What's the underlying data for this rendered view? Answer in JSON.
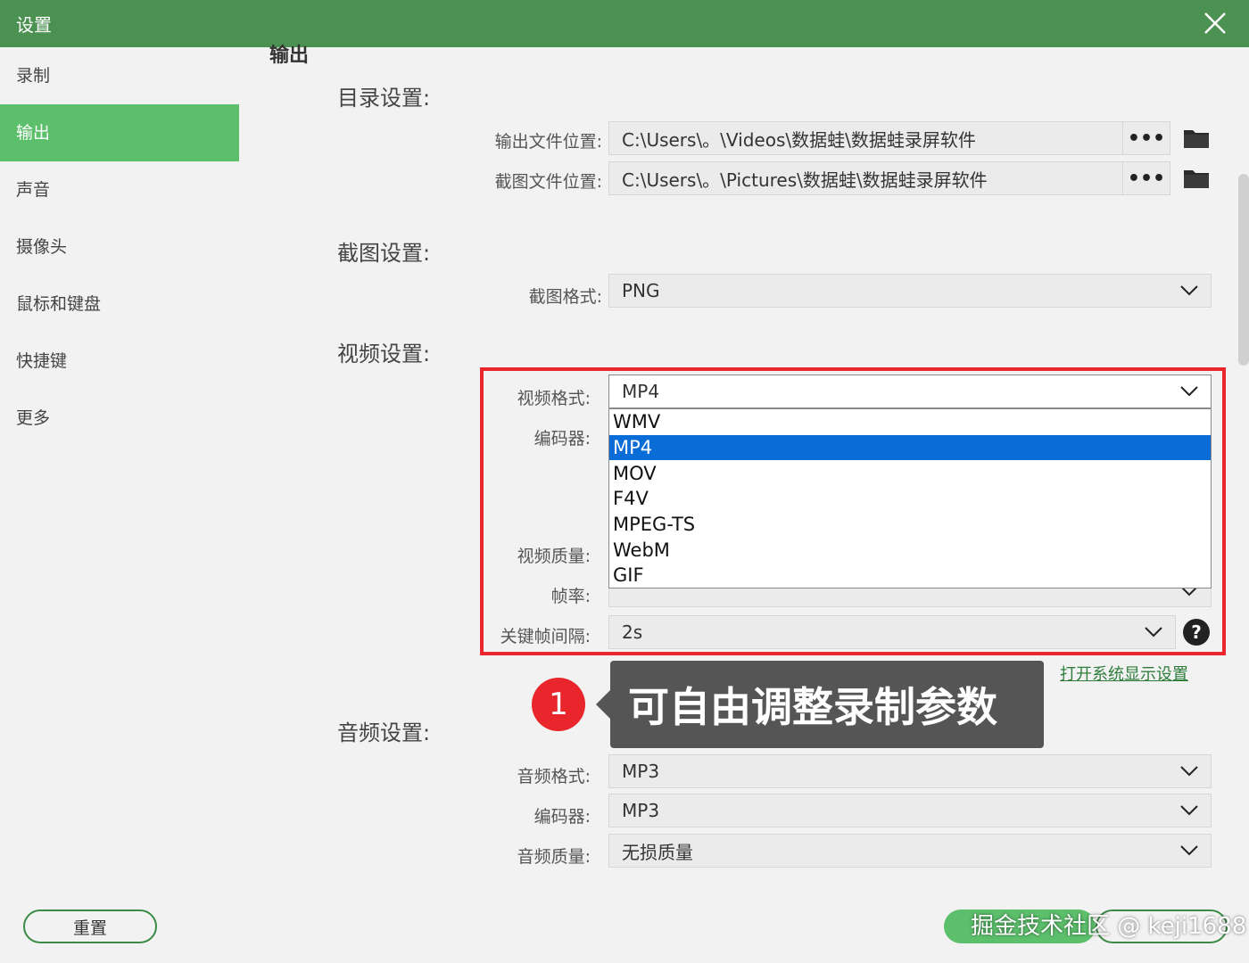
{
  "window": {
    "title": "设置"
  },
  "sidebar": {
    "items": [
      {
        "label": "录制"
      },
      {
        "label": "输出",
        "active": true
      },
      {
        "label": "声音"
      },
      {
        "label": "摄像头"
      },
      {
        "label": "鼠标和键盘"
      },
      {
        "label": "快捷键"
      },
      {
        "label": "更多"
      }
    ]
  },
  "page": {
    "heading": "输出"
  },
  "directory": {
    "heading": "目录设置:",
    "output_label": "输出文件位置:",
    "output_path": "C:\\Users\\。\\Videos\\数据蛙\\数据蛙录屏软件",
    "screenshot_label": "截图文件位置:",
    "screenshot_path": "C:\\Users\\。\\Pictures\\数据蛙\\数据蛙录屏软件",
    "browse_label": "•••"
  },
  "screenshot": {
    "heading": "截图设置:",
    "format_label": "截图格式:",
    "format_value": "PNG"
  },
  "video": {
    "heading": "视频设置:",
    "format_label": "视频格式:",
    "format_value": "MP4",
    "encoder_label": "编码器:",
    "quality_label": "视频质量:",
    "fps_label": "帧率:",
    "keyframe_label": "关键帧间隔:",
    "keyframe_value": "2s",
    "options": [
      "WMV",
      "MP4",
      "MOV",
      "F4V",
      "MPEG-TS",
      "WebM",
      "GIF"
    ],
    "selected_option": "MP4"
  },
  "display_link": "打开系统显示设置",
  "annotation": {
    "number": "1",
    "text": "可自由调整录制参数"
  },
  "audio": {
    "heading": "音频设置:",
    "format_label": "音频格式:",
    "format_value": "MP3",
    "encoder_label": "编码器:",
    "encoder_value": "MP3",
    "quality_label": "音频质量:",
    "quality_value": "无损质量"
  },
  "footer": {
    "reset_label": "重置"
  },
  "watermark": "掘金技术社区 @ keji1688",
  "colors": {
    "titlebar": "#4b9152",
    "accent": "#5cbf6b",
    "highlight_box": "#e8262b",
    "selection": "#0a6cd6"
  }
}
